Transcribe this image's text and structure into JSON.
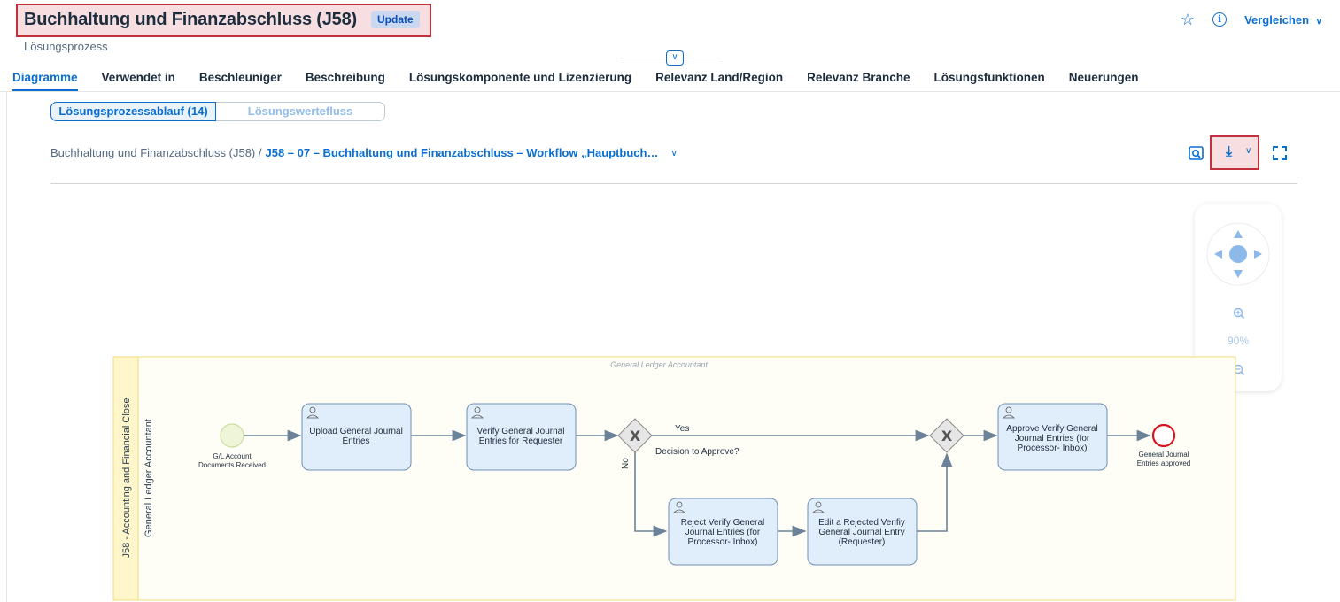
{
  "header": {
    "title": "Buchhaltung und Finanzabschluss (J58)",
    "badge": "Update",
    "subtitle": "Lösungsprozess",
    "compare_label": "Vergleichen",
    "icons": [
      "star-icon",
      "info-icon",
      "chevron-down-icon"
    ]
  },
  "tabs": [
    {
      "label": "Diagramme",
      "active": true
    },
    {
      "label": "Verwendet in"
    },
    {
      "label": "Beschleuniger"
    },
    {
      "label": "Beschreibung"
    },
    {
      "label": "Lösungskomponente und Lizenzierung"
    },
    {
      "label": "Relevanz Land/Region"
    },
    {
      "label": "Relevanz Branche"
    },
    {
      "label": "Lösungsfunktionen"
    },
    {
      "label": "Neuerungen"
    }
  ],
  "segmented": {
    "option1": "Lösungsprozessablauf (14)",
    "option2": "Lösungswertefluss"
  },
  "breadcrumb": {
    "root": "Buchhaltung und Finanzabschluss (J58) /",
    "current": "J58 – 07 – Buchhaltung und Finanzabschluss – Workflow „Hauptbuch…"
  },
  "navigator": {
    "zoom": "90%"
  },
  "diagram": {
    "pool_label": "J58 - Accounting and Financial Close",
    "lane_label": "General Ledger Accountant",
    "lane_header": "General Ledger Accountant",
    "start_event": [
      "G/L Account",
      "Documents Received"
    ],
    "end_event": [
      "General Journal",
      "Entries approved"
    ],
    "tasks": {
      "upload": [
        "Upload General Journal",
        "Entries"
      ],
      "verify": [
        "Verify General Journal",
        "Entries for Requester"
      ],
      "reject": [
        "Reject Verify General",
        "Journal Entries (for",
        "Processor- Inbox)"
      ],
      "edit": [
        "Edit a Rejected Verifiy",
        "General Journal Entry",
        "(Requester)"
      ],
      "approve": [
        "Approve Verify General",
        "Journal Entries (for",
        "Processor- Inbox)"
      ]
    },
    "gateway_label": "Decision to Approve?",
    "yes_label": "Yes",
    "no_label": "No",
    "colors": {
      "task_fill": "#e0eefc",
      "task_stroke": "#6f8fb5",
      "pool_fill": "#fff6cc",
      "pool_stroke": "#f0dc7a",
      "start_fill": "#eef5d8",
      "end_stroke": "#d7141e"
    }
  }
}
